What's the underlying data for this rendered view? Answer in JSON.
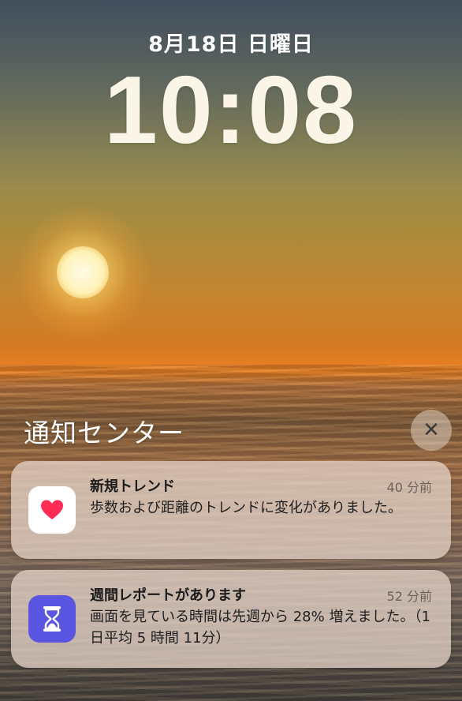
{
  "lockscreen": {
    "date": "8月18日 日曜日",
    "time": "10:08"
  },
  "notification_center": {
    "title": "通知センター",
    "close_glyph": "✕"
  },
  "notifications": [
    {
      "app_icon": "heart-icon",
      "title": "新規トレンド",
      "time": "40 分前",
      "body": "歩数および距離のトレンドに変化がありました。"
    },
    {
      "app_icon": "hourglass-icon",
      "title": "週間レポートがあります",
      "time": "52 分前",
      "body": "画面を見ている時間は先週から 28% 増えました。（1日平均 5 時間 11分）"
    }
  ],
  "colors": {
    "health_icon_bg": "#ffffff",
    "heart": "#ff2d55",
    "screentime_icon_bg": "#5a55e0"
  }
}
